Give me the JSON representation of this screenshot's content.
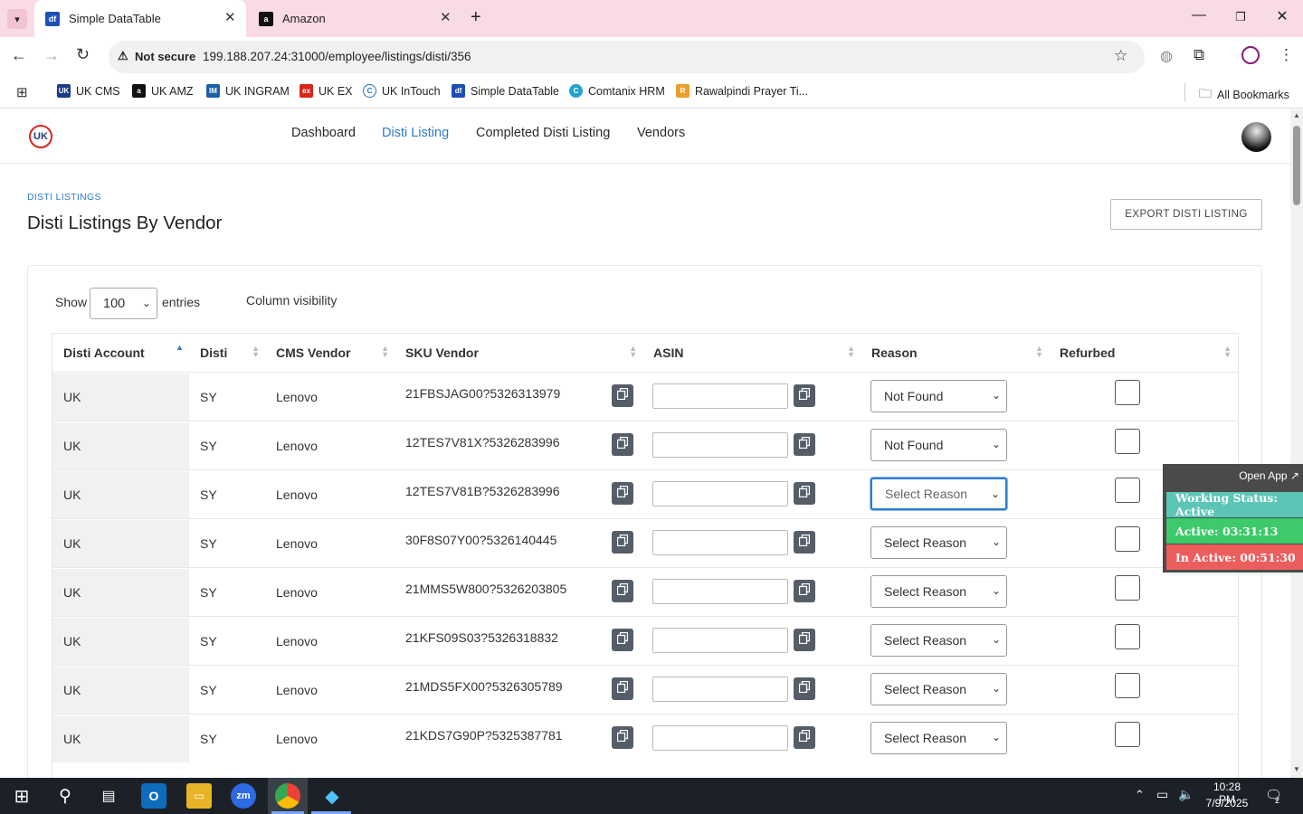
{
  "browser": {
    "tabs": [
      {
        "title": "Simple DataTable",
        "favicon": "df"
      },
      {
        "title": "Amazon",
        "favicon": "a"
      }
    ],
    "security_label": "Not secure",
    "url": "199.188.207.24:31000/employee/listings/disti/356",
    "bookmarks": [
      {
        "label": "UK CMS",
        "icon": "UK"
      },
      {
        "label": "UK AMZ",
        "icon": "a"
      },
      {
        "label": "UK INGRAM",
        "icon": "IM"
      },
      {
        "label": "UK EX",
        "icon": "ex"
      },
      {
        "label": "UK InTouch",
        "icon": "C"
      },
      {
        "label": "Simple DataTable",
        "icon": "df"
      },
      {
        "label": "Comtanix HRM",
        "icon": "C"
      },
      {
        "label": "Rawalpindi Prayer Ti...",
        "icon": "R"
      }
    ],
    "all_bookmarks": "All Bookmarks"
  },
  "nav": {
    "logo": "UK",
    "links": [
      "Dashboard",
      "Disti Listing",
      "Completed Disti Listing",
      "Vendors"
    ],
    "active": "Disti Listing"
  },
  "header": {
    "breadcrumb": "DISTI LISTINGS",
    "title": "Disti Listings By Vendor",
    "export_button": "EXPORT DISTI LISTING"
  },
  "controls": {
    "show_label": "Show",
    "entries_value": "100",
    "entries_label": "entries",
    "column_visibility": "Column visibility"
  },
  "table": {
    "columns": [
      "Disti Account",
      "Disti",
      "CMS Vendor",
      "SKU Vendor",
      "ASIN",
      "Reason",
      "Refurbed"
    ],
    "rows": [
      {
        "account": "UK",
        "disti": "SY",
        "vendor": "Lenovo",
        "sku": "21FBSJAG00?5326313979",
        "asin": "",
        "reason": "Not Found",
        "refurbed": false
      },
      {
        "account": "UK",
        "disti": "SY",
        "vendor": "Lenovo",
        "sku": "12TES7V81X?5326283996",
        "asin": "",
        "reason": "Not Found",
        "refurbed": false
      },
      {
        "account": "UK",
        "disti": "SY",
        "vendor": "Lenovo",
        "sku": "12TES7V81B?5326283996",
        "asin": "",
        "reason": "Select Reason",
        "refurbed": false
      },
      {
        "account": "UK",
        "disti": "SY",
        "vendor": "Lenovo",
        "sku": "30F8S07Y00?5326140445",
        "asin": "",
        "reason": "Select Reason",
        "refurbed": false
      },
      {
        "account": "UK",
        "disti": "SY",
        "vendor": "Lenovo",
        "sku": "21MMS5W800?5326203805",
        "asin": "",
        "reason": "Select Reason",
        "refurbed": false
      },
      {
        "account": "UK",
        "disti": "SY",
        "vendor": "Lenovo",
        "sku": "21KFS09S03?5326318832",
        "asin": "",
        "reason": "Select Reason",
        "refurbed": false
      },
      {
        "account": "UK",
        "disti": "SY",
        "vendor": "Lenovo",
        "sku": "21MDS5FX00?5326305789",
        "asin": "",
        "reason": "Select Reason",
        "refurbed": false
      },
      {
        "account": "UK",
        "disti": "SY",
        "vendor": "Lenovo",
        "sku": "21KDS7G90P?5325387781",
        "asin": "",
        "reason": "Select Reason",
        "refurbed": false
      }
    ]
  },
  "widget": {
    "open_app": "Open App ↗",
    "status": "Working Status: Active",
    "active": "Active: 03:31:13",
    "inactive": "In Active: 00:51:30"
  },
  "taskbar": {
    "time": "10:28 PM",
    "date": "7/9/2025",
    "notifications": "2"
  },
  "colors": {
    "tabstrip": "#f9dbe6",
    "accent": "#2b7cd3",
    "status_active": "#5cc6b6",
    "active_green": "#3ec96a",
    "inactive_red": "#ec5d5d"
  }
}
